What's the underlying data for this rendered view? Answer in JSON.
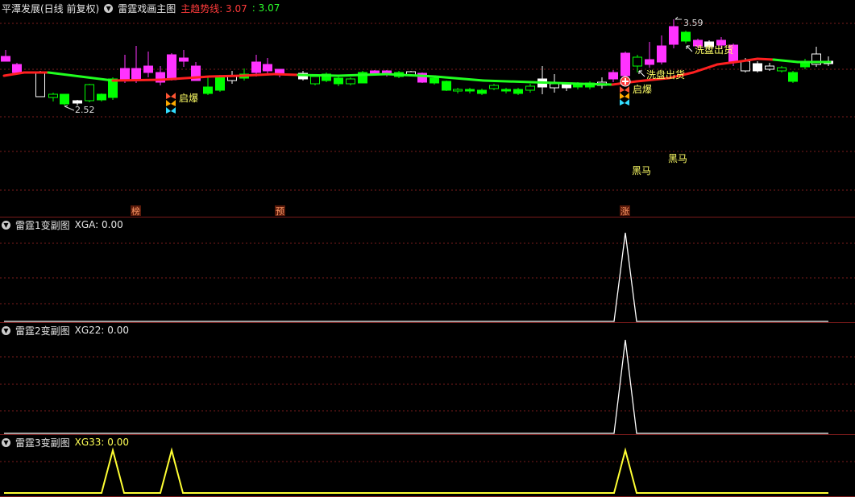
{
  "main_panel": {
    "title": "平潭发展(日线 前复权)",
    "indicator": "雷霆戏画主图",
    "trend_label": "主趋势线: 3.07",
    "trend_value2": ": 3.07",
    "high_label": "3.59",
    "low_label": "2.52",
    "annotations": {
      "qibao_1": "启爆",
      "qibao_2": "启爆",
      "xipan_1": "洗盘出货",
      "xipan_2": "洗盘出货",
      "heima_1": "黑马",
      "heima_2": "黑马",
      "tag_bang": "榜",
      "tag_yu": "预",
      "tag_zhang": "涨"
    }
  },
  "sub_panels": [
    {
      "title": "雷霆1变副图",
      "value": "XGA: 0.00"
    },
    {
      "title": "雷霆2变副图",
      "value": "XG22: 0.00"
    },
    {
      "title": "雷霆3变副图",
      "value": "XG33: 0.00"
    }
  ],
  "colors": {
    "up": "#ff33ff",
    "down": "#00ff00",
    "flat": "#ffffff",
    "trend_up": "#ff2020",
    "trend_down": "#20ff20",
    "grid": "#7a1b1b",
    "signal_white": "#ffffff",
    "signal_yellow": "#ffff33"
  }
}
